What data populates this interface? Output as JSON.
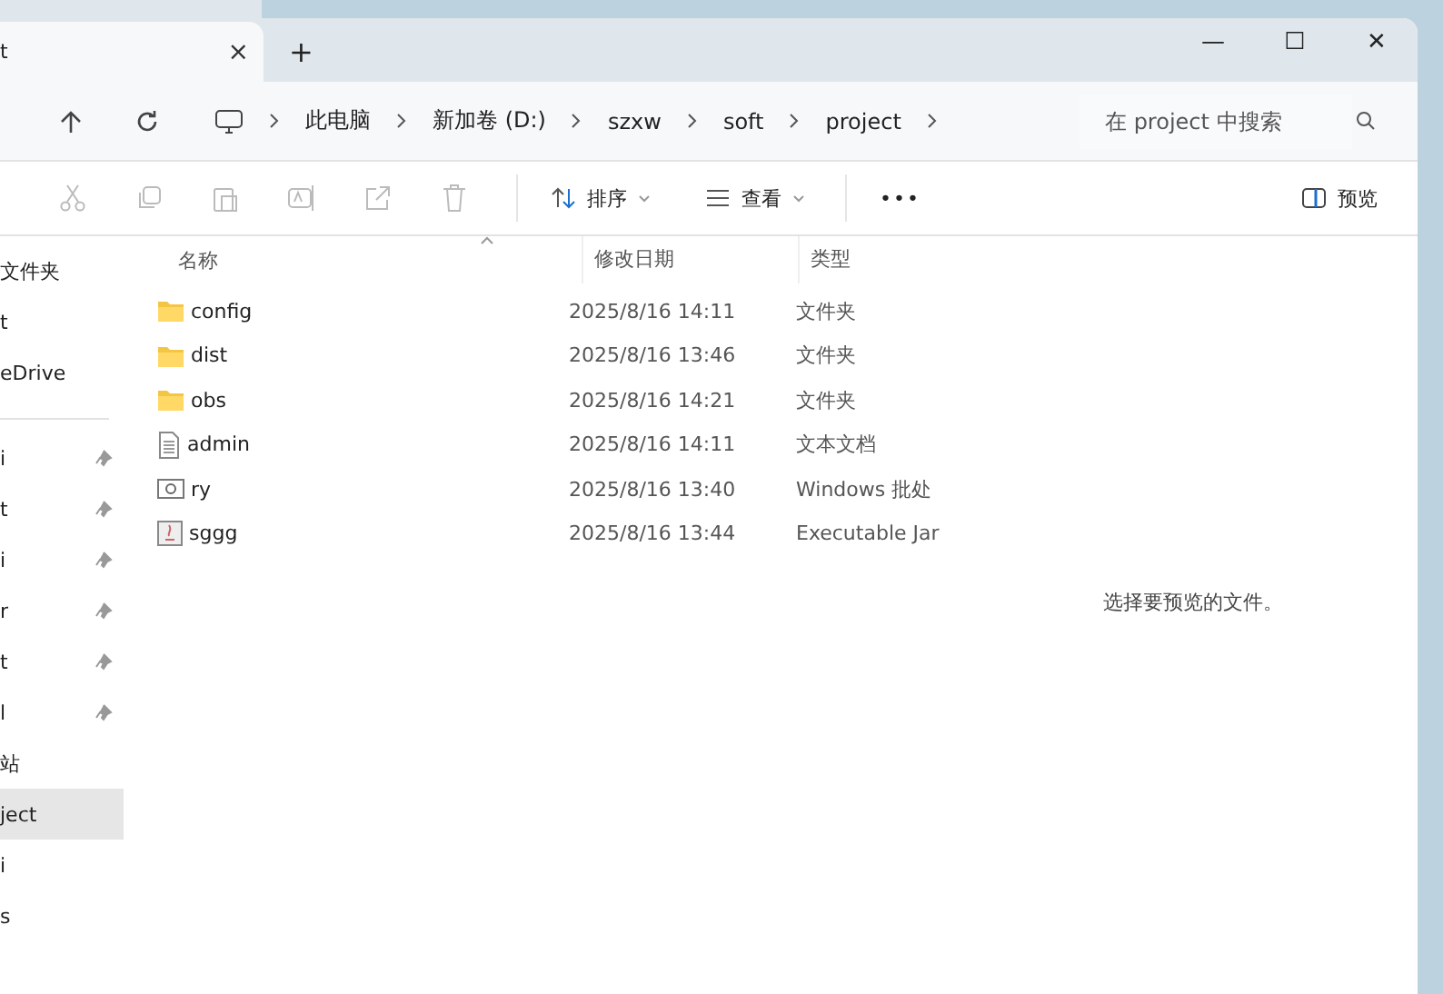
{
  "tab": {
    "title": "t",
    "close": "×",
    "new_tab": "+"
  },
  "window_controls": {
    "minimize": "—",
    "maximize": "☐",
    "close": "✕"
  },
  "address_bar": {
    "crumbs": [
      "此电脑",
      "新加卷 (D:)",
      "szxw",
      "soft",
      "project"
    ]
  },
  "search": {
    "placeholder": "在 project 中搜索"
  },
  "toolbar": {
    "sort": "排序",
    "view": "查看",
    "more": "•••",
    "preview": "预览"
  },
  "sidebar": {
    "items": [
      {
        "label": "文件夹",
        "pinned": false,
        "selected": false
      },
      {
        "label": "t",
        "pinned": false,
        "selected": false
      },
      {
        "label": "eDrive",
        "pinned": false,
        "selected": false
      },
      {
        "kind": "divider"
      },
      {
        "label": "i",
        "pinned": true,
        "selected": false
      },
      {
        "label": "t",
        "pinned": true,
        "selected": false
      },
      {
        "label": "i",
        "pinned": true,
        "selected": false
      },
      {
        "label": "r",
        "pinned": true,
        "selected": false
      },
      {
        "label": "t",
        "pinned": true,
        "selected": false
      },
      {
        "label": "l",
        "pinned": true,
        "selected": false
      },
      {
        "label": "站",
        "pinned": false,
        "selected": false
      },
      {
        "label": "ject",
        "pinned": false,
        "selected": true
      },
      {
        "label": "i",
        "pinned": false,
        "selected": false
      },
      {
        "label": "s",
        "pinned": false,
        "selected": false
      }
    ]
  },
  "table": {
    "columns": [
      "名称",
      "修改日期",
      "类型"
    ],
    "rows": [
      {
        "kind": "folder",
        "name": "config",
        "modified": "2025/8/16 14:11",
        "type": "文件夹"
      },
      {
        "kind": "folder",
        "name": "dist",
        "modified": "2025/8/16 13:46",
        "type": "文件夹"
      },
      {
        "kind": "folder",
        "name": "obs",
        "modified": "2025/8/16 14:21",
        "type": "文件夹"
      },
      {
        "kind": "text",
        "name": "admin",
        "modified": "2025/8/16 14:11",
        "type": "文本文档"
      },
      {
        "kind": "batch",
        "name": "ry",
        "modified": "2025/8/16 13:40",
        "type": "Windows 批处"
      },
      {
        "kind": "jar",
        "name": "sggg",
        "modified": "2025/8/16 13:44",
        "type": "Executable Jar"
      }
    ]
  },
  "preview_pane": {
    "message": "选择要预览的文件。"
  }
}
